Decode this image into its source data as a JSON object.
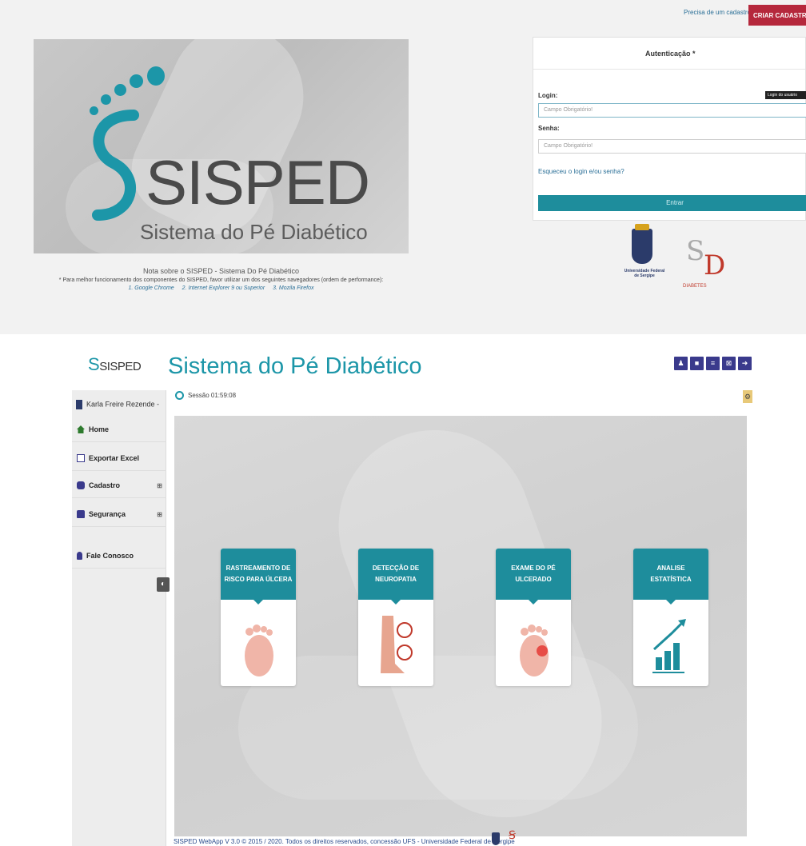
{
  "login": {
    "register_prompt": "Precisa de um cadastro?",
    "create_button": "CRIAR CADASTRO",
    "logo": {
      "word": "SISPED",
      "subtitle": "Sistema do Pé Diabético"
    },
    "note": {
      "title": "Nota sobre o SISPED - Sistema Do Pé Diabético",
      "text": "* Para melhor funcionamento dos componentes do SISPED, favor utilizar um dos seguintes navegadores (ordem de performance):",
      "browsers": [
        "1. Google Chrome",
        "2. Internet Explorer 9 ou Superior",
        "3. Mozila Firefox"
      ]
    },
    "auth": {
      "title": "Autenticação *",
      "login_label": "Login:",
      "login_badge": "Login do usuário",
      "login_placeholder": "Campo Obrigatório!",
      "password_label": "Senha:",
      "password_placeholder": "Campo Obrigatório!",
      "forgot": "Esqueceu o login e/ou senha?",
      "enter": "Entrar"
    },
    "logos": {
      "ufs": "Universidade Federal de Sergipe",
      "sbd": "DIABETES"
    }
  },
  "app": {
    "logo": "SISPED",
    "title": "Sistema do Pé Diabético",
    "user": "Karla Freire Rezende -",
    "session": "Sessão  01:59:08",
    "menu": [
      {
        "label": "Home",
        "icon": "home-icon"
      },
      {
        "label": "Exportar Excel",
        "icon": "excel-icon"
      },
      {
        "label": "Cadastro",
        "icon": "database-icon",
        "expand": "⊞"
      },
      {
        "label": "Segurança",
        "icon": "lock-icon",
        "expand": "⊞"
      },
      {
        "label": "Fale Conosco",
        "icon": "microphone-icon"
      }
    ],
    "toolbar_icons": [
      "user-icon",
      "lock-icon",
      "list-icon",
      "sitemap-icon",
      "logout-icon"
    ],
    "cards": [
      {
        "line1": "RASTREAMENTO DE",
        "line2": "RISCO PARA ÚLCERA"
      },
      {
        "line1": "DETECÇÃO DE",
        "line2": "NEUROPATIA"
      },
      {
        "line1": "EXAME DO PÉ",
        "line2": "ULCERADO"
      },
      {
        "line1": "ANALISE",
        "line2": "ESTATÍSTICA"
      }
    ],
    "footer": "SISPED WebApp V 3.0 © 2015 / 2020. Todos os direitos reservados, concessão UFS - Universidade Federal de Sergipe"
  },
  "colors": {
    "primary": "#1e8d9c",
    "accent": "#b5283c",
    "toolbar": "#3a3a8c"
  }
}
